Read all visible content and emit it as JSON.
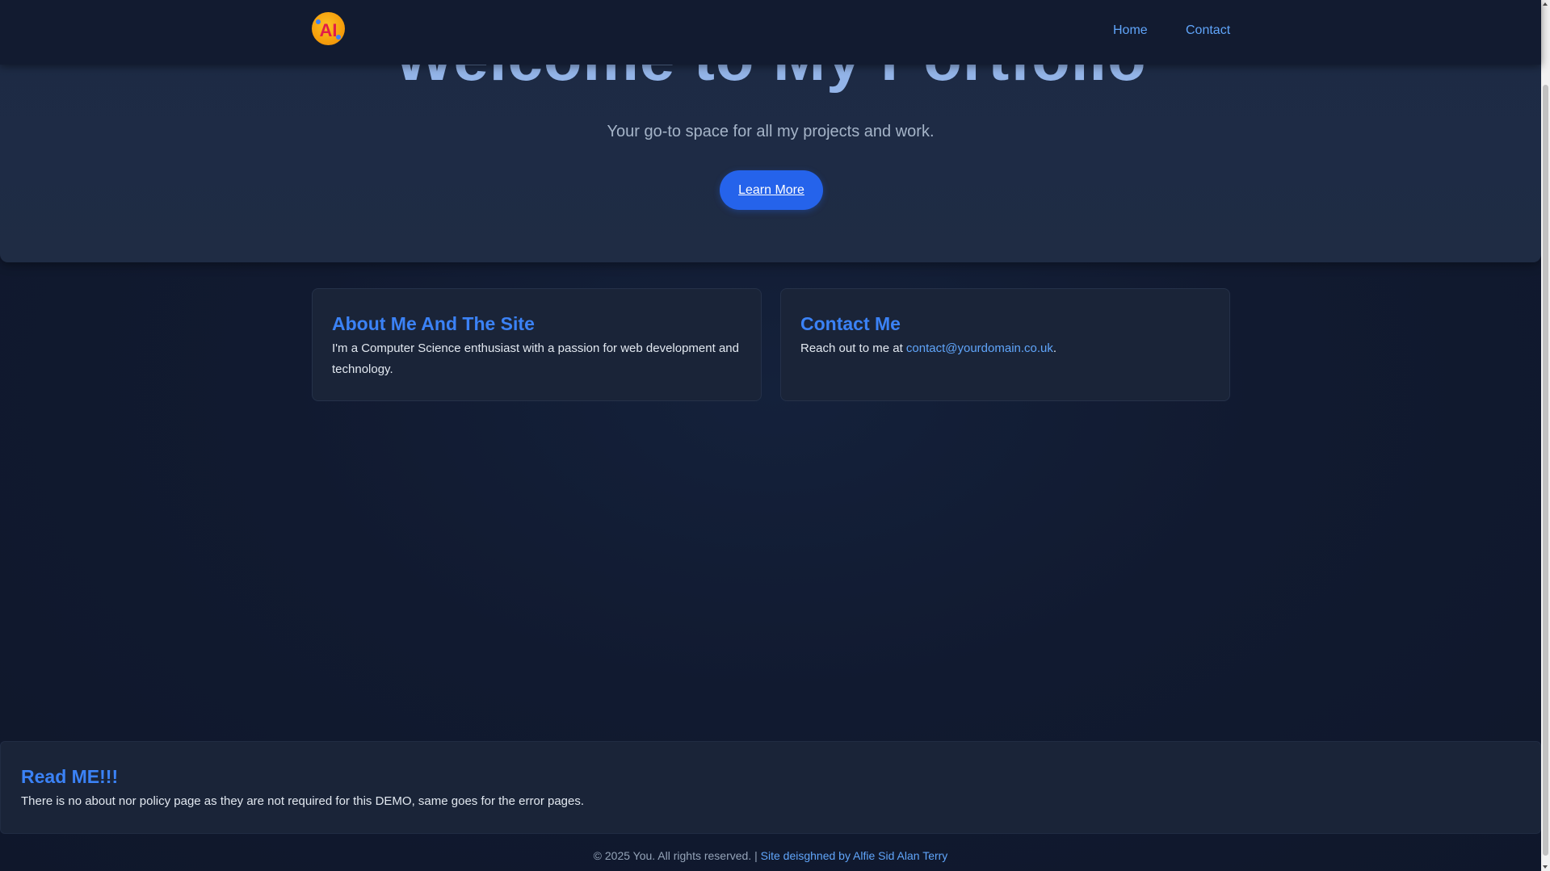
{
  "nav": {
    "logo_icon": "ai-logo-icon",
    "links": [
      {
        "label": "Home"
      },
      {
        "label": "Contact"
      }
    ]
  },
  "hero": {
    "title": "Welcome to My Portfolio",
    "subtitle": "Your go-to space for all my projects and work.",
    "button_label": "Learn More"
  },
  "cards": {
    "about": {
      "title": "About Me And The Site",
      "text": "I'm a Computer Science enthusiast with a passion for web development and technology."
    },
    "contact": {
      "title": "Contact Me",
      "text_prefix": "Reach out to me at ",
      "email": "contact@yourdomain.co.uk",
      "text_suffix": "."
    }
  },
  "readme": {
    "title": "Read ME!!!",
    "text": "There is no about nor policy page as they are not required for this DEMO, same goes for the error pages."
  },
  "footer": {
    "copyright": "© 2025 You. All rights reserved. | ",
    "credit": "Site deisghned by Alfie Sid Alan Terry"
  },
  "colors": {
    "accent": "#3b82f6",
    "link": "#60a5fa",
    "button": "#2563eb",
    "background": "#111a30",
    "card": "#1a2438"
  }
}
